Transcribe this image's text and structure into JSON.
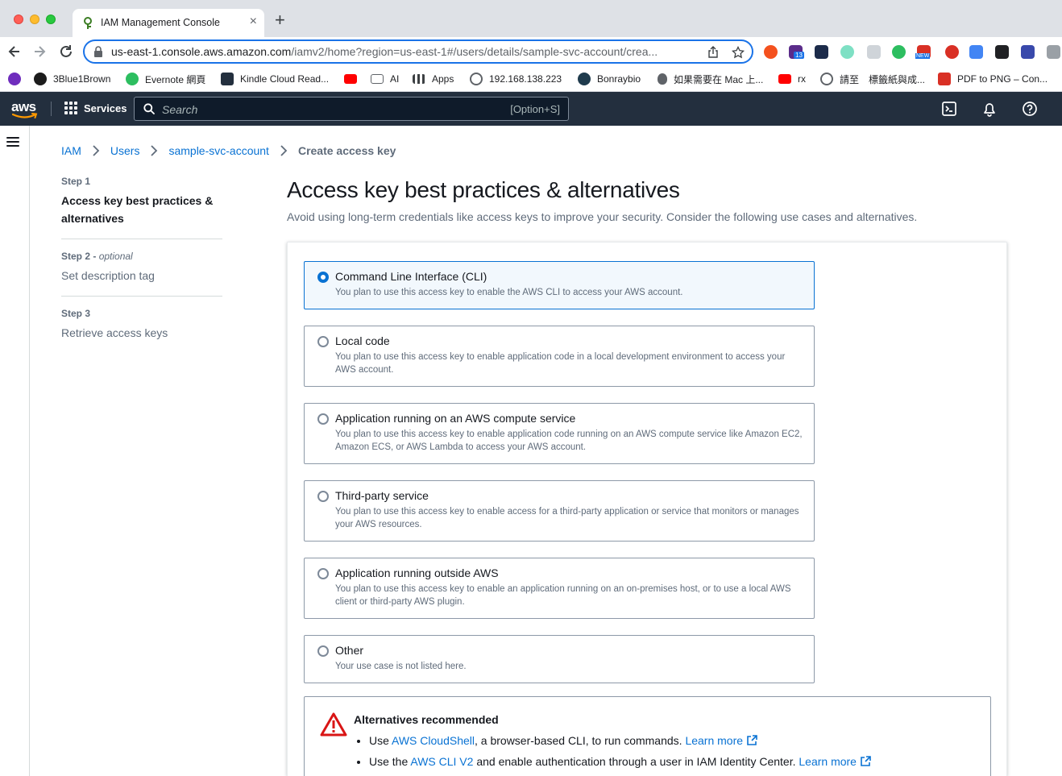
{
  "browser": {
    "tab_title": "IAM Management Console",
    "tab_close": "×",
    "new_tab": "+",
    "url_host": "us-east-1.console.aws.amazon.com",
    "url_rest": "/iamv2/home?region=us-east-1#/users/details/sample-svc-account/crea...",
    "extension_badges": [
      "13",
      "NEW"
    ],
    "bookmarks": [
      {
        "label": "3Blue1Brown",
        "color": "#1c1c1c"
      },
      {
        "label": "Evernote 網頁",
        "color": "#2dbe60"
      },
      {
        "label": "Kindle Cloud Read...",
        "color": "#232f3e"
      },
      {
        "label": "",
        "color": "#ff0000"
      },
      {
        "label": "AI",
        "color": "#5f6368"
      },
      {
        "label": "Apps",
        "color": "#5f6368"
      },
      {
        "label": "192.168.138.223",
        "color": "#5f6368"
      },
      {
        "label": "Bonraybio",
        "color": "#1f3b4d"
      },
      {
        "label": "如果需要在 Mac 上...",
        "color": "#5f6368"
      },
      {
        "label": "rx",
        "color": "#ff0000"
      },
      {
        "label": "請至",
        "color": "#5f6368"
      },
      {
        "label": "標籤紙與成...",
        "color": "#5f6368"
      },
      {
        "label": "PDF to PNG – Con...",
        "color": "#d93025"
      }
    ]
  },
  "aws_nav": {
    "logo": "aws",
    "services_label": "Services",
    "search_placeholder": "Search",
    "search_shortcut": "[Option+S]"
  },
  "breadcrumb": {
    "items": [
      "IAM",
      "Users",
      "sample-svc-account"
    ],
    "current": "Create access key"
  },
  "steps": [
    {
      "num": "Step 1",
      "optional": "",
      "title": "Access key best practices & alternatives",
      "active": true
    },
    {
      "num": "Step 2 - ",
      "optional": "optional",
      "title": "Set description tag",
      "active": false
    },
    {
      "num": "Step 3",
      "optional": "",
      "title": "Retrieve access keys",
      "active": false
    }
  ],
  "main": {
    "title": "Access key best practices & alternatives",
    "description": "Avoid using long-term credentials like access keys to improve your security. Consider the following use cases and alternatives."
  },
  "options": [
    {
      "label": "Command Line Interface (CLI)",
      "desc": "You plan to use this access key to enable the AWS CLI to access your AWS account.",
      "selected": true
    },
    {
      "label": "Local code",
      "desc": "You plan to use this access key to enable application code in a local development environment to access your AWS account.",
      "selected": false
    },
    {
      "label": "Application running on an AWS compute service",
      "desc": "You plan to use this access key to enable application code running on an AWS compute service like Amazon EC2, Amazon ECS, or AWS Lambda to access your AWS account.",
      "selected": false
    },
    {
      "label": "Third-party service",
      "desc": "You plan to use this access key to enable access for a third-party application or service that monitors or manages your AWS resources.",
      "selected": false
    },
    {
      "label": "Application running outside AWS",
      "desc": "You plan to use this access key to enable an application running on an on-premises host, or to use a local AWS client or third-party AWS plugin.",
      "selected": false
    },
    {
      "label": "Other",
      "desc": "Your use case is not listed here.",
      "selected": false
    }
  ],
  "alert": {
    "title": "Alternatives recommended",
    "items": [
      {
        "prefix": "Use ",
        "link": "AWS CloudShell",
        "suffix": ", a browser-based CLI, to run commands. ",
        "learn_more": "Learn more"
      },
      {
        "prefix": "Use the ",
        "link": "AWS CLI V2",
        "suffix": " and enable authentication through a user in IAM Identity Center. ",
        "learn_more": "Learn more"
      }
    ]
  },
  "colors": {
    "aws_nav_bg": "#232f3e",
    "link_blue": "#0972d3",
    "warning_red": "#d91515",
    "selected_bg": "#f2f8fd"
  }
}
